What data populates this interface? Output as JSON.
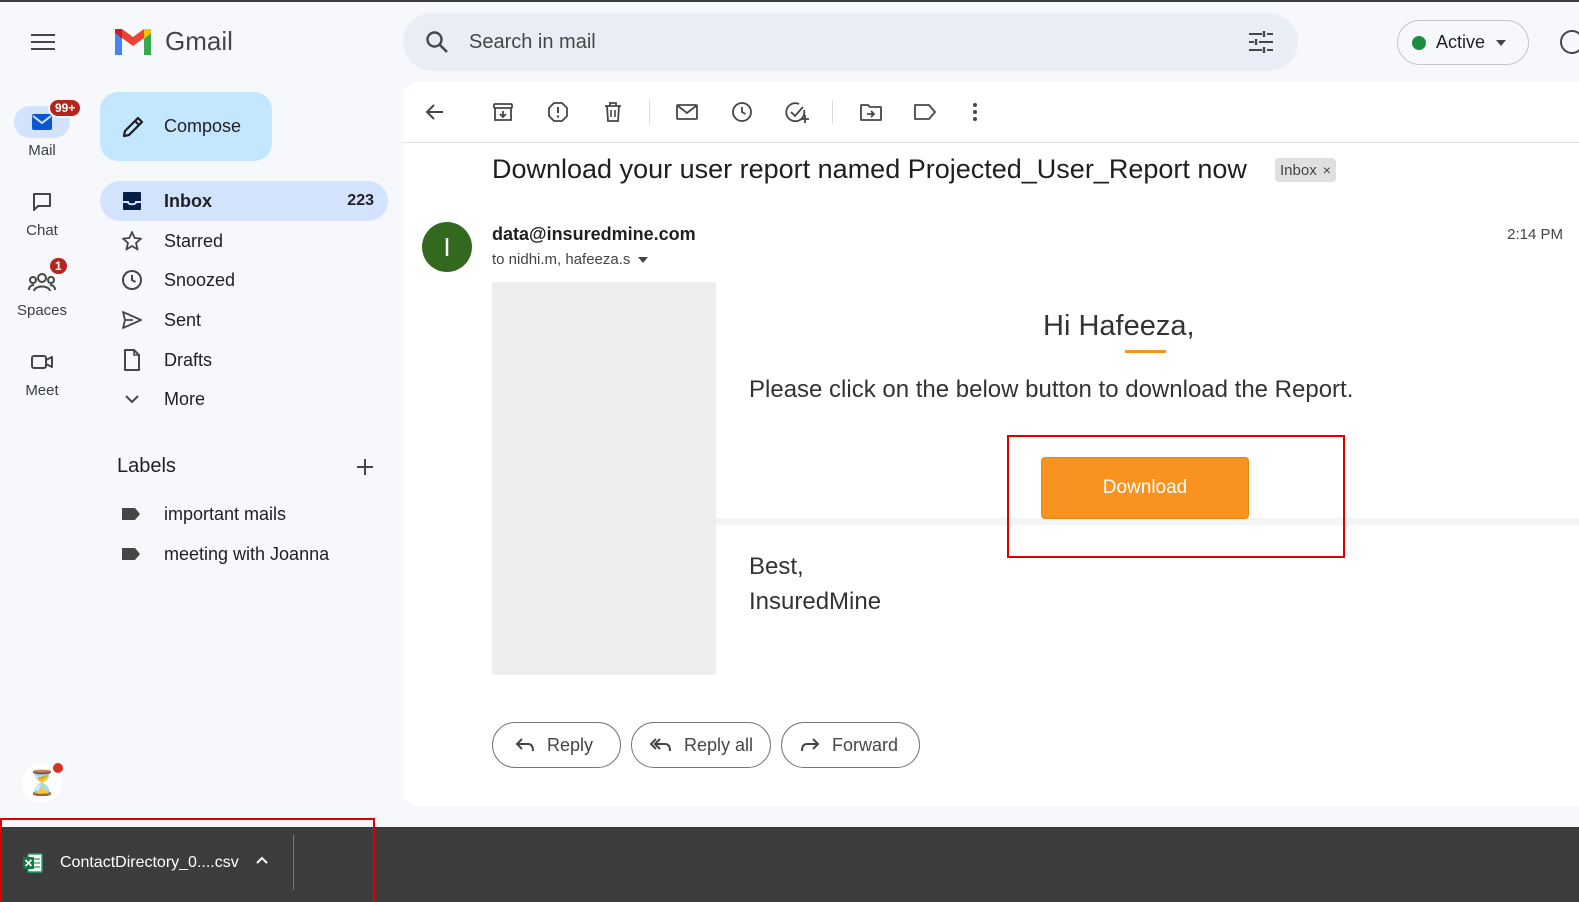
{
  "app": {
    "name": "Gmail"
  },
  "rail": {
    "mail": {
      "label": "Mail",
      "badge": "99+"
    },
    "chat": {
      "label": "Chat"
    },
    "spaces": {
      "label": "Spaces",
      "badge": "1"
    },
    "meet": {
      "label": "Meet"
    }
  },
  "nav": {
    "compose_label": "Compose",
    "items": [
      {
        "label": "Inbox",
        "count": "223"
      },
      {
        "label": "Starred"
      },
      {
        "label": "Snoozed"
      },
      {
        "label": "Sent"
      },
      {
        "label": "Drafts"
      },
      {
        "label": "More"
      }
    ],
    "labels_heading": "Labels",
    "labels": [
      {
        "label": "important mails"
      },
      {
        "label": "meeting with Joanna"
      }
    ]
  },
  "search": {
    "placeholder": "Search in mail"
  },
  "status": {
    "label": "Active",
    "color": "#1e8e3e"
  },
  "email": {
    "subject": "Download your user report named Projected_User_Report now",
    "tag": "Inbox",
    "tag_close": "×",
    "avatar_letter": "I",
    "sender": "data@insuredmine.com",
    "recipients": "to nidhi.m, hafeeza.s",
    "time": "2:14 PM",
    "body": {
      "greeting": "Hi Hafeeza,",
      "instruction": "Please click on the below button to download the Report.",
      "download_label": "Download",
      "sign_off": "Best,",
      "signature": "InsuredMine"
    },
    "actions": {
      "reply": "Reply",
      "reply_all": "Reply all",
      "forward": "Forward"
    }
  },
  "download_bar": {
    "file_name": "ContactDirectory_0....csv"
  },
  "colors": {
    "accent": "#f7931e",
    "highlight": "#e00000",
    "compose": "#c2e7ff",
    "active_nav": "#d3e3fd"
  }
}
